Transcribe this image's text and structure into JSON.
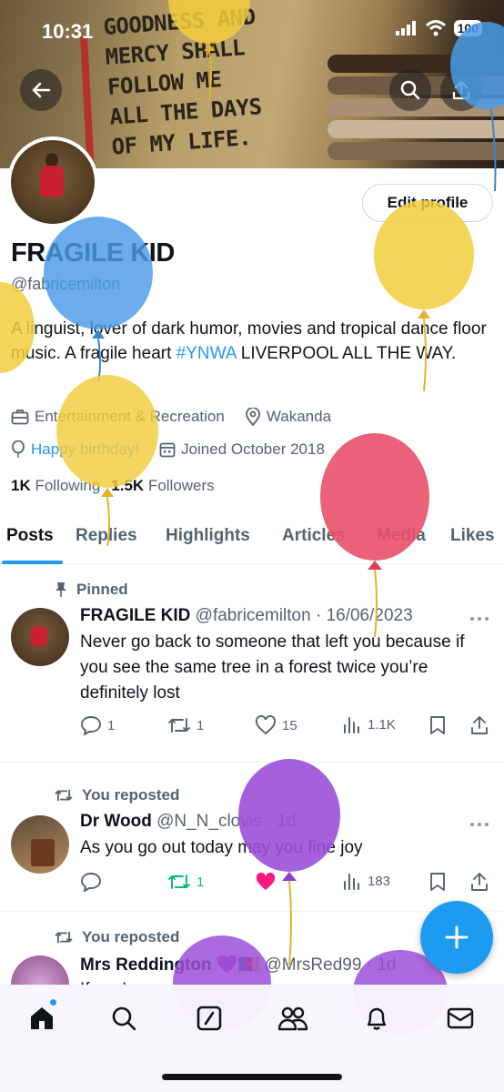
{
  "status": {
    "time": "10:31",
    "battery": "100"
  },
  "banner": {
    "shirt_lines": "GOODNESS AND\nMERCY SHALL\nFOLLOW ME\nALL THE DAYS\nOF MY LIFE."
  },
  "profile": {
    "edit_label": "Edit profile",
    "name": "FRAGILE KID",
    "handle": "@fabricemilton",
    "bio_before": "A linguist, lover of dark humor, movies and tropical dance floor music. A fragile heart ",
    "bio_tag": "#YNWA",
    "bio_after": " LIVERPOOL ALL THE WAY.",
    "category": "Entertainment & Recreation",
    "location": "Wakanda",
    "birthday": "Happy birthday!",
    "joined": "Joined October 2018",
    "following_count": "1K",
    "following_label": "Following",
    "followers_count": "1.5K",
    "followers_label": "Followers"
  },
  "tabs": [
    "Posts",
    "Replies",
    "Highlights",
    "Articles",
    "Media",
    "Likes"
  ],
  "posts": [
    {
      "context": "Pinned",
      "name": "FRAGILE KID",
      "handle": "@fabricemilton",
      "date": "16/06/2023",
      "text": "Never go back to someone that left you because if you see the same tree in a forest twice you’re definitely lost",
      "replies": "1",
      "reposts": "1",
      "likes": "15",
      "views": "1.1K"
    },
    {
      "context": "You reposted",
      "name": "Dr Wood",
      "handle": "@N_N_clovis",
      "date": "1d",
      "text": "As you go out today may you fine joy",
      "replies": "",
      "reposts": "1",
      "likes": "",
      "views": "183"
    },
    {
      "context": "You reposted",
      "name": "Mrs Reddington 💜🇨🇲",
      "handle": "@MrsRed99",
      "date": "1d",
      "text": "If you’re …",
      "replies": "",
      "reposts": "",
      "likes": "",
      "views": ""
    }
  ],
  "colors": {
    "accent": "#1d9bf0",
    "repost_green": "#00ba7c",
    "like_pink": "#f91880"
  },
  "nav_icons": [
    "home-icon",
    "search-icon",
    "grok-icon",
    "communities-icon",
    "notifications-icon",
    "messages-icon"
  ]
}
